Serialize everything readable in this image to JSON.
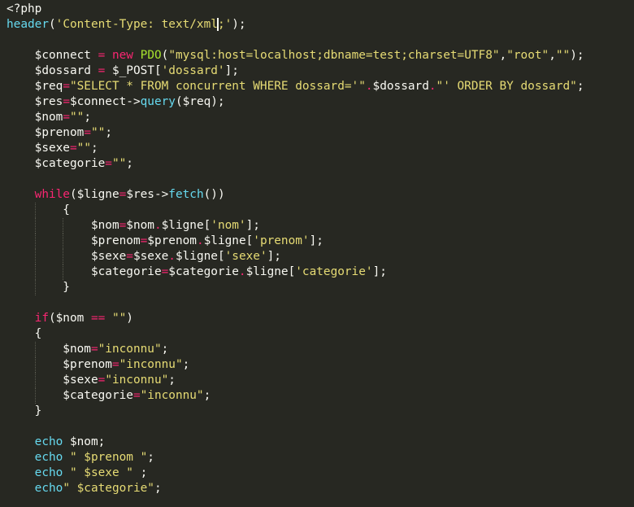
{
  "colors": {
    "background": "#272822",
    "default": "#f8f8f2",
    "keyword": "#f92672",
    "function": "#66d9ef",
    "string": "#e6db74",
    "class": "#a6e22e"
  },
  "lines": [
    {
      "segs": [
        {
          "t": "<?php",
          "c": "default"
        }
      ]
    },
    {
      "segs": [
        {
          "t": "header",
          "c": "function"
        },
        {
          "t": "(",
          "c": "default"
        },
        {
          "t": "'Content-Type: text/xml",
          "c": "string"
        },
        {
          "t": "caret",
          "c": "caret"
        },
        {
          "t": ";'",
          "c": "string"
        },
        {
          "t": ");",
          "c": "default"
        }
      ]
    },
    {
      "segs": []
    },
    {
      "segs": [
        {
          "t": "    $connect ",
          "c": "default"
        },
        {
          "t": "=",
          "c": "keyword"
        },
        {
          "t": " ",
          "c": "default"
        },
        {
          "t": "new",
          "c": "keyword"
        },
        {
          "t": " ",
          "c": "default"
        },
        {
          "t": "PDO",
          "c": "class"
        },
        {
          "t": "(",
          "c": "default"
        },
        {
          "t": "\"mysql:host=localhost;dbname=test;charset=UTF8\"",
          "c": "string"
        },
        {
          "t": ",",
          "c": "default"
        },
        {
          "t": "\"root\"",
          "c": "string"
        },
        {
          "t": ",",
          "c": "default"
        },
        {
          "t": "\"\"",
          "c": "string"
        },
        {
          "t": ");",
          "c": "default"
        }
      ]
    },
    {
      "segs": [
        {
          "t": "    $dossard ",
          "c": "default"
        },
        {
          "t": "=",
          "c": "keyword"
        },
        {
          "t": " $_POST[",
          "c": "default"
        },
        {
          "t": "'dossard'",
          "c": "string"
        },
        {
          "t": "];",
          "c": "default"
        }
      ]
    },
    {
      "segs": [
        {
          "t": "    $req",
          "c": "default"
        },
        {
          "t": "=",
          "c": "keyword"
        },
        {
          "t": "\"SELECT * FROM concurrent WHERE dossard='\"",
          "c": "string"
        },
        {
          "t": ".",
          "c": "keyword"
        },
        {
          "t": "$dossard",
          "c": "default"
        },
        {
          "t": ".",
          "c": "keyword"
        },
        {
          "t": "\"' ORDER BY dossard\"",
          "c": "string"
        },
        {
          "t": ";",
          "c": "default"
        }
      ]
    },
    {
      "segs": [
        {
          "t": "    $res",
          "c": "default"
        },
        {
          "t": "=",
          "c": "keyword"
        },
        {
          "t": "$connect->",
          "c": "default"
        },
        {
          "t": "query",
          "c": "function"
        },
        {
          "t": "($req);",
          "c": "default"
        }
      ]
    },
    {
      "segs": [
        {
          "t": "    $nom",
          "c": "default"
        },
        {
          "t": "=",
          "c": "keyword"
        },
        {
          "t": "\"\"",
          "c": "string"
        },
        {
          "t": ";",
          "c": "default"
        }
      ]
    },
    {
      "segs": [
        {
          "t": "    $prenom",
          "c": "default"
        },
        {
          "t": "=",
          "c": "keyword"
        },
        {
          "t": "\"\"",
          "c": "string"
        },
        {
          "t": ";",
          "c": "default"
        }
      ]
    },
    {
      "segs": [
        {
          "t": "    $sexe",
          "c": "default"
        },
        {
          "t": "=",
          "c": "keyword"
        },
        {
          "t": "\"\"",
          "c": "string"
        },
        {
          "t": ";",
          "c": "default"
        }
      ]
    },
    {
      "segs": [
        {
          "t": "    $categorie",
          "c": "default"
        },
        {
          "t": "=",
          "c": "keyword"
        },
        {
          "t": "\"\"",
          "c": "string"
        },
        {
          "t": ";",
          "c": "default"
        }
      ]
    },
    {
      "segs": []
    },
    {
      "segs": [
        {
          "t": "    ",
          "c": "default"
        },
        {
          "t": "while",
          "c": "keyword"
        },
        {
          "t": "($ligne",
          "c": "default"
        },
        {
          "t": "=",
          "c": "keyword"
        },
        {
          "t": "$res->",
          "c": "default"
        },
        {
          "t": "fetch",
          "c": "function"
        },
        {
          "t": "())",
          "c": "default"
        }
      ]
    },
    {
      "segs": [
        {
          "t": "        {",
          "c": "default"
        }
      ]
    },
    {
      "segs": [
        {
          "t": "            $nom",
          "c": "default"
        },
        {
          "t": "=",
          "c": "keyword"
        },
        {
          "t": "$nom",
          "c": "default"
        },
        {
          "t": ".",
          "c": "keyword"
        },
        {
          "t": "$ligne[",
          "c": "default"
        },
        {
          "t": "'nom'",
          "c": "string"
        },
        {
          "t": "];",
          "c": "default"
        }
      ]
    },
    {
      "segs": [
        {
          "t": "            $prenom",
          "c": "default"
        },
        {
          "t": "=",
          "c": "keyword"
        },
        {
          "t": "$prenom",
          "c": "default"
        },
        {
          "t": ".",
          "c": "keyword"
        },
        {
          "t": "$ligne[",
          "c": "default"
        },
        {
          "t": "'prenom'",
          "c": "string"
        },
        {
          "t": "];",
          "c": "default"
        }
      ]
    },
    {
      "segs": [
        {
          "t": "            $sexe",
          "c": "default"
        },
        {
          "t": "=",
          "c": "keyword"
        },
        {
          "t": "$sexe",
          "c": "default"
        },
        {
          "t": ".",
          "c": "keyword"
        },
        {
          "t": "$ligne[",
          "c": "default"
        },
        {
          "t": "'sexe'",
          "c": "string"
        },
        {
          "t": "];",
          "c": "default"
        }
      ]
    },
    {
      "segs": [
        {
          "t": "            $categorie",
          "c": "default"
        },
        {
          "t": "=",
          "c": "keyword"
        },
        {
          "t": "$categorie",
          "c": "default"
        },
        {
          "t": ".",
          "c": "keyword"
        },
        {
          "t": "$ligne[",
          "c": "default"
        },
        {
          "t": "'categorie'",
          "c": "string"
        },
        {
          "t": "];",
          "c": "default"
        }
      ]
    },
    {
      "segs": [
        {
          "t": "        }",
          "c": "default"
        }
      ]
    },
    {
      "segs": []
    },
    {
      "segs": [
        {
          "t": "    ",
          "c": "default"
        },
        {
          "t": "if",
          "c": "keyword"
        },
        {
          "t": "($nom ",
          "c": "default"
        },
        {
          "t": "==",
          "c": "keyword"
        },
        {
          "t": " ",
          "c": "default"
        },
        {
          "t": "\"\"",
          "c": "string"
        },
        {
          "t": ")",
          "c": "default"
        }
      ]
    },
    {
      "segs": [
        {
          "t": "    {",
          "c": "default"
        }
      ]
    },
    {
      "segs": [
        {
          "t": "        $nom",
          "c": "default"
        },
        {
          "t": "=",
          "c": "keyword"
        },
        {
          "t": "\"inconnu\"",
          "c": "string"
        },
        {
          "t": ";",
          "c": "default"
        }
      ]
    },
    {
      "segs": [
        {
          "t": "        $prenom",
          "c": "default"
        },
        {
          "t": "=",
          "c": "keyword"
        },
        {
          "t": "\"inconnu\"",
          "c": "string"
        },
        {
          "t": ";",
          "c": "default"
        }
      ]
    },
    {
      "segs": [
        {
          "t": "        $sexe",
          "c": "default"
        },
        {
          "t": "=",
          "c": "keyword"
        },
        {
          "t": "\"inconnu\"",
          "c": "string"
        },
        {
          "t": ";",
          "c": "default"
        }
      ]
    },
    {
      "segs": [
        {
          "t": "        $categorie",
          "c": "default"
        },
        {
          "t": "=",
          "c": "keyword"
        },
        {
          "t": "\"inconnu\"",
          "c": "string"
        },
        {
          "t": ";",
          "c": "default"
        }
      ]
    },
    {
      "segs": [
        {
          "t": "    }",
          "c": "default"
        }
      ]
    },
    {
      "segs": []
    },
    {
      "segs": [
        {
          "t": "    ",
          "c": "default"
        },
        {
          "t": "echo",
          "c": "function"
        },
        {
          "t": " $nom;",
          "c": "default"
        }
      ]
    },
    {
      "segs": [
        {
          "t": "    ",
          "c": "default"
        },
        {
          "t": "echo",
          "c": "function"
        },
        {
          "t": " ",
          "c": "default"
        },
        {
          "t": "\" $prenom \"",
          "c": "string"
        },
        {
          "t": ";",
          "c": "default"
        }
      ]
    },
    {
      "segs": [
        {
          "t": "    ",
          "c": "default"
        },
        {
          "t": "echo",
          "c": "function"
        },
        {
          "t": " ",
          "c": "default"
        },
        {
          "t": "\" $sexe \"",
          "c": "string"
        },
        {
          "t": " ;",
          "c": "default"
        }
      ]
    },
    {
      "segs": [
        {
          "t": "    ",
          "c": "default"
        },
        {
          "t": "echo",
          "c": "function"
        },
        {
          "t": "\" $categorie\"",
          "c": "string"
        },
        {
          "t": ";",
          "c": "default"
        }
      ]
    }
  ]
}
